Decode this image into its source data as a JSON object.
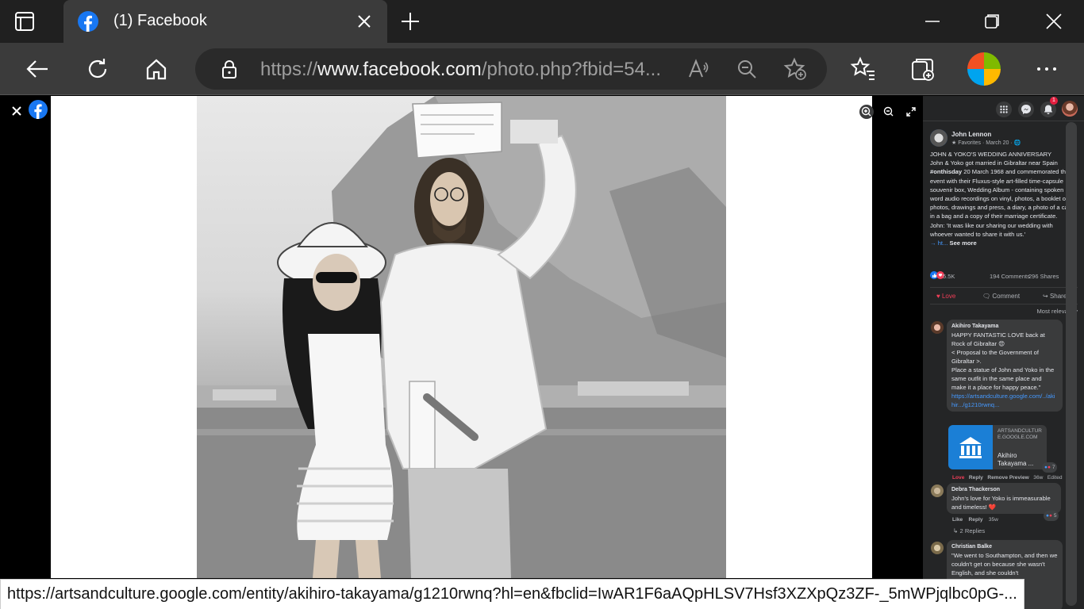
{
  "browser": {
    "tab_title": "(1) Facebook",
    "url_scheme": "https://",
    "url_host": "www.facebook.com",
    "url_path": "/photo.php?fbid=54...",
    "status_url": "https://artsandculture.google.com/entity/akihiro-takayama/g1210rwnq?hl=en&fbclid=IwAR1F6aAQpHLSV7Hsf3XZXpQz3ZF-_5mWPjqlbc0pG-..."
  },
  "colors": {
    "facebook_blue": "#1877f2",
    "love_red": "#f33e58",
    "link_blue": "#4599ff",
    "panel_bg": "#242526"
  },
  "panel": {
    "notification_count": "1",
    "post": {
      "author": "John Lennon",
      "meta": "Favorites · March 20 ·",
      "line_title": "JOHN & YOKO'S WEDDING ANNIVERSARY",
      "line_body_1": "John & Yoko got married in Gibraltar near Spain",
      "hashtag": "#onthisday",
      "line_body_2": "20 March 1968 and commemorated the event with their Fluxus-style art-filled time-capsule souvenir box, Wedding Album - containing spoken word audio recordings on vinyl, photos, a booklet of photos, drawings and press, a diary, a photo of a cake in a bag and a copy of their marriage certificate.",
      "line_quote": "John: 'It was like our sharing our wedding with whoever wanted to share it with us.'",
      "arrow_link": "→ ht...",
      "see_more": "See more",
      "reactions_count": "5.5K",
      "comments_count": "194 Comments",
      "shares_count": "296 Shares",
      "love_label": "Love",
      "comment_label": "Comment",
      "share_label": "Share",
      "sort_label": "Most relevant"
    },
    "comments": [
      {
        "name": "Akihiro Takayama",
        "text_1": "HAPPY FANTASTIC LOVE back at Rock of Gibraltar 😍",
        "text_2": "< Proposal to the Government of Gibraltar >.",
        "text_3": "Place a statue of John and Yoko in the same outfit in the same place and make it a place for happy peace.\"",
        "link": "https://artsandculture.google.com/../akihir.../g1210rwnq...",
        "card_domain": "ARTSANDCULTURE.GOOGLE.COM",
        "card_title": "Akihiro Takayama ...",
        "reaction_count": "7",
        "action_love": "Love",
        "action_reply": "Reply",
        "action_remove": "Remove Preview",
        "time": "36w",
        "edited": "Edited"
      },
      {
        "name": "Debra Thackerson",
        "text_1": "John's love for Yoko is immeasurable and timeless! ❤️",
        "reaction_count": "5",
        "action_like": "Like",
        "action_reply": "Reply",
        "time": "35w",
        "replies": "2 Replies"
      },
      {
        "name": "Christian Balke",
        "text_1": "\"We went to Southampton, and then we couldn't get on because she wasn't English, and she couldn't"
      }
    ]
  }
}
